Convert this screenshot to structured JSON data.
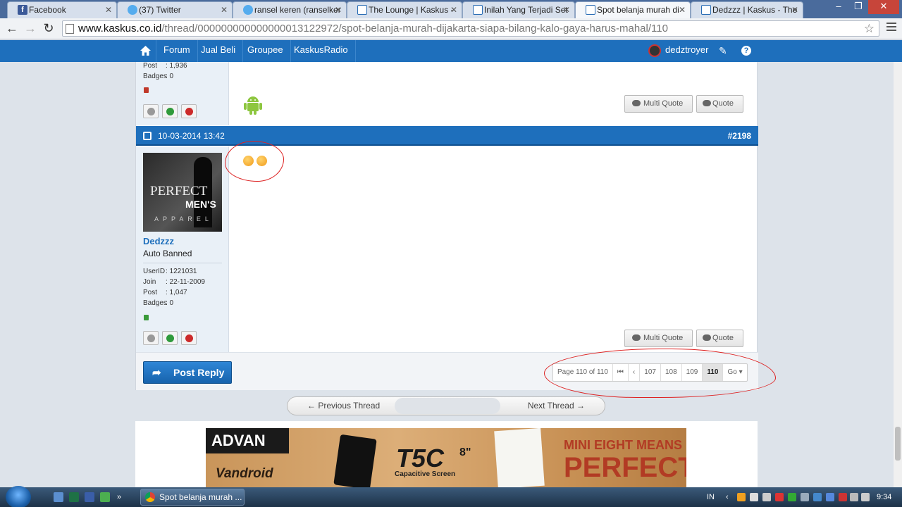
{
  "browser": {
    "tabs": [
      {
        "title": "Facebook",
        "favicon": "facebook-icon"
      },
      {
        "title": "(37) Twitter",
        "favicon": "twitter-icon"
      },
      {
        "title": "ransel keren (ranselker",
        "favicon": "twitter-icon"
      },
      {
        "title": "The Lounge | Kaskus -",
        "favicon": "kaskus-icon"
      },
      {
        "title": "Inilah Yang Terjadi Set",
        "favicon": "kaskus-icon"
      },
      {
        "title": "Spot belanja murah di",
        "favicon": "kaskus-icon"
      },
      {
        "title": "Dedzzz | Kaskus - The",
        "favicon": "kaskus-icon"
      }
    ],
    "url_host": "www.kaskus.co.id",
    "url_path": "/thread/000000000000000013122972/spot-belanja-murah-dijakarta-siapa-bilang-kalo-gaya-harus-mahal/110"
  },
  "site_nav": {
    "items": [
      "Forum",
      "Jual Beli",
      "Groupee",
      "KaskusRadio"
    ],
    "username": "dedztroyer"
  },
  "prev_post": {
    "stats": [
      {
        "key": "Post",
        "value": ": 1,936"
      },
      {
        "key": "Badges",
        "value": ": 0"
      }
    ],
    "status_color": "#c0392b"
  },
  "post": {
    "date": "10-03-2014 13:42",
    "number": "#2198",
    "username": "Dedzzz",
    "user_title": "Auto Banned",
    "avatar_text": {
      "line1": "PERFECT",
      "line2": "MEN'S",
      "line3": "APPAREL"
    },
    "stats": [
      {
        "key": "UserID",
        "value": ": 1221031"
      },
      {
        "key": "Join",
        "value": ": 22-11-2009"
      },
      {
        "key": "Post",
        "value": ": 1,047"
      },
      {
        "key": "Badges",
        "value": ": 0"
      }
    ],
    "status_color": "#3a9a3a"
  },
  "buttons": {
    "multi_quote": "Multi Quote",
    "quote": "Quote",
    "post_reply": "Post Reply"
  },
  "pager": {
    "label": "Page 110 of 110",
    "pages": [
      "107",
      "108",
      "109",
      "110"
    ],
    "current": "110",
    "go": "Go"
  },
  "thread_nav": {
    "prev": "Previous Thread",
    "next": "Next Thread"
  },
  "ad": {
    "brand": "ADVAN",
    "product": "Vandroid",
    "model": "T5C",
    "size": "8\"",
    "feature": "Capacitive Screen",
    "tagline_top": "MINI EIGHT MEANS",
    "tagline_bottom": "PERFECT"
  },
  "taskbar": {
    "window": "Spot belanja murah ...",
    "lang": "IN",
    "time": "9:34"
  }
}
